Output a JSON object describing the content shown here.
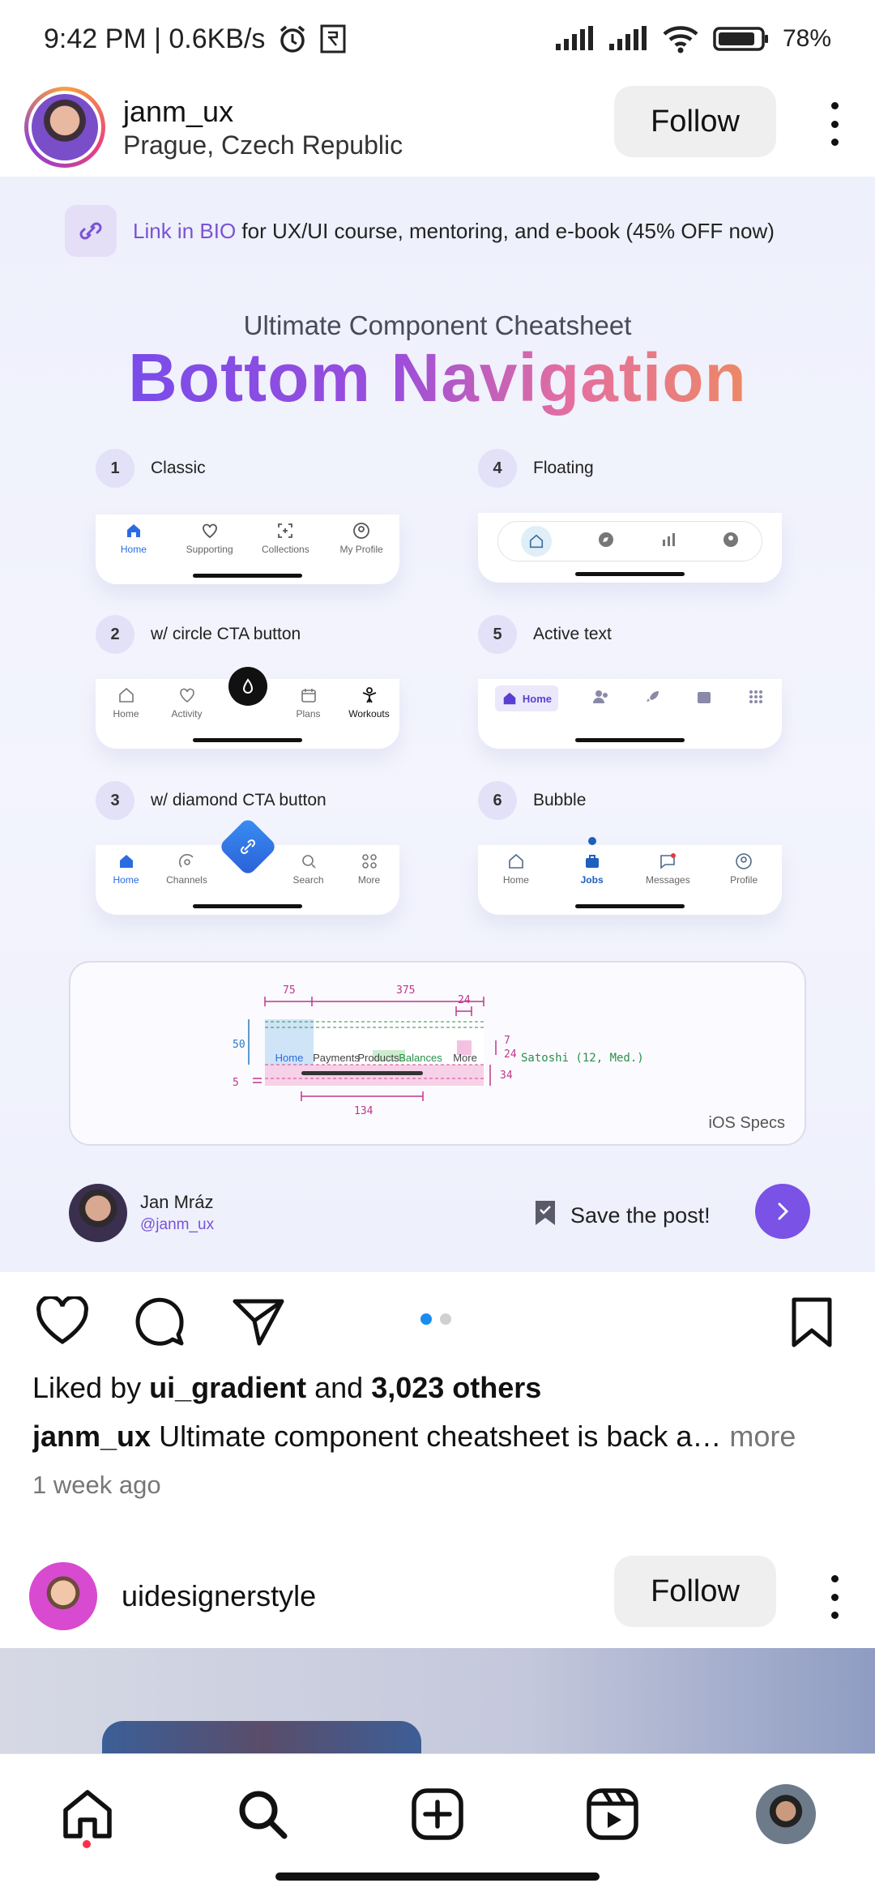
{
  "status_bar": {
    "time_speed": "9:42 PM | 0.6KB/s",
    "battery_pct": "78%"
  },
  "post": {
    "username": "janm_ux",
    "location": "Prague, Czech Republic",
    "follow_label": "Follow",
    "image": {
      "bio_link": "Link in BIO",
      "bio_rest": " for UX/UI course, mentoring, and e-book (45% OFF now)",
      "subtitle": "Ultimate Component Cheatsheet",
      "title": "Bottom Navigation",
      "variants": [
        {
          "num": "1",
          "label": "Classic",
          "items": [
            "Home",
            "Supporting",
            "Collections",
            "My Profile"
          ]
        },
        {
          "num": "2",
          "label": "w/ circle CTA button",
          "items": [
            "Home",
            "Activity",
            "Plans",
            "Workouts"
          ]
        },
        {
          "num": "3",
          "label": "w/ diamond CTA button",
          "items": [
            "Home",
            "Channels",
            "Search",
            "More"
          ]
        },
        {
          "num": "4",
          "label": "Floating"
        },
        {
          "num": "5",
          "label": "Active text",
          "items": [
            "Home"
          ]
        },
        {
          "num": "6",
          "label": "Bubble",
          "items": [
            "Home",
            "Jobs",
            "Messages",
            "Profile"
          ]
        }
      ],
      "specs": {
        "dims": [
          "75",
          "375",
          "24",
          "7",
          "24",
          "50",
          "5",
          "34",
          "134"
        ],
        "items": [
          "Home",
          "Payments",
          "Products",
          "Balances",
          "More"
        ],
        "font_note": "Satoshi (12, Med.)",
        "caption": "iOS Specs"
      },
      "author_name": "Jan Mráz",
      "author_handle": "@janm_ux",
      "save_label": "Save the post!"
    },
    "liked_prefix": "Liked by ",
    "liked_user": "ui_gradient",
    "liked_and": " and ",
    "liked_count": "3,023 others",
    "caption_user": "janm_ux",
    "caption_text": " Ultimate component cheatsheet is back a…",
    "caption_more": " more",
    "time_ago": "1 week ago"
  },
  "next_post": {
    "username": "uidesignerstyle",
    "follow_label": "Follow"
  },
  "colors": {
    "accent_purple": "#7a52d6",
    "carousel_active": "#1a8cf0",
    "notification_dot": "#ff2d4a"
  },
  "bottom_nav": [
    "home-icon",
    "search-icon",
    "create-icon",
    "reels-icon",
    "profile-avatar"
  ]
}
